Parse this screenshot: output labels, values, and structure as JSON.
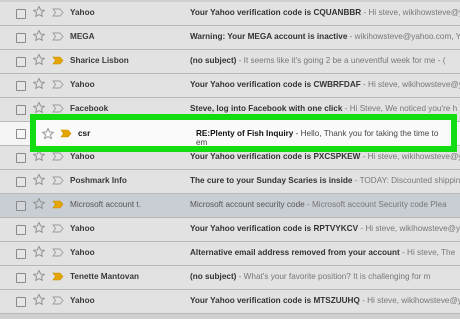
{
  "colors": {
    "highlight_border": "#12dd12",
    "important_marker": "#e5a500",
    "unread_row": "#e2e2e2",
    "read_row": "#c9cdd4"
  },
  "icons": {
    "checkbox": "checkbox-icon",
    "star": "star-icon",
    "important": "importance-marker-icon"
  },
  "emails": [
    {
      "sender": "Yahoo",
      "subject": "Your Yahoo verification code is CQUANBBR",
      "snippet": " - Hi steve, wikihowsteve@yaho",
      "important": false
    },
    {
      "sender": "MEGA",
      "subject": "Warning: Your MEGA account is inactive",
      "snippet": " - wikihowsteve@yahoo.com, You",
      "important": false
    },
    {
      "sender": "Sharice Lisbon",
      "subject": "(no subject)",
      "snippet": " - It seems like it's going 2 be a uneventful week for me - (",
      "important": true
    },
    {
      "sender": "Yahoo",
      "subject": "Your Yahoo verification code is CWBRFDAF",
      "snippet": " - Hi steve, wikihowsteve@yahoo",
      "important": false
    },
    {
      "sender": "Facebook",
      "subject": "Steve, log into Facebook with one click",
      "snippet": " - Hi Steve, We noticed you're h",
      "important": false
    },
    {
      "sender": "csr",
      "subject": "RE:Plenty of Fish Inquiry",
      "snippet": " - Hello, Thank you for taking the time to em",
      "important": true
    },
    {
      "sender": "Yahoo",
      "subject": "Your Yahoo verification code is PXCSPKEW",
      "snippet": " - Hi steve, wikihowsteve@yahoo.c",
      "important": false
    },
    {
      "sender": "Poshmark Info",
      "subject": "The cure to your Sunday Scaries is inside",
      "snippet": " - TODAY: Discounted shipping",
      "important": false
    },
    {
      "sender": "Microsoft account t.",
      "subject": "Microsoft account security code",
      "snippet": " - Microsoft account Security code Plea",
      "important": true
    },
    {
      "sender": "Yahoo",
      "subject": "Your Yahoo verification code is RPTVYKCV",
      "snippet": " - Hi steve, wikihowsteve@yahoo.c",
      "important": false
    },
    {
      "sender": "Yahoo",
      "subject": "Alternative email address removed from your account",
      "snippet": " - Hi steve, The",
      "important": false
    },
    {
      "sender": "Tenette Mantovan",
      "subject": "(no subject)",
      "snippet": " - What's your favorite position? It is challenging for m",
      "important": true
    },
    {
      "sender": "Yahoo",
      "subject": "Your Yahoo verification code is MTSZUUHQ",
      "snippet": " - Hi steve, wikihowsteve@yahoo",
      "important": false
    }
  ]
}
